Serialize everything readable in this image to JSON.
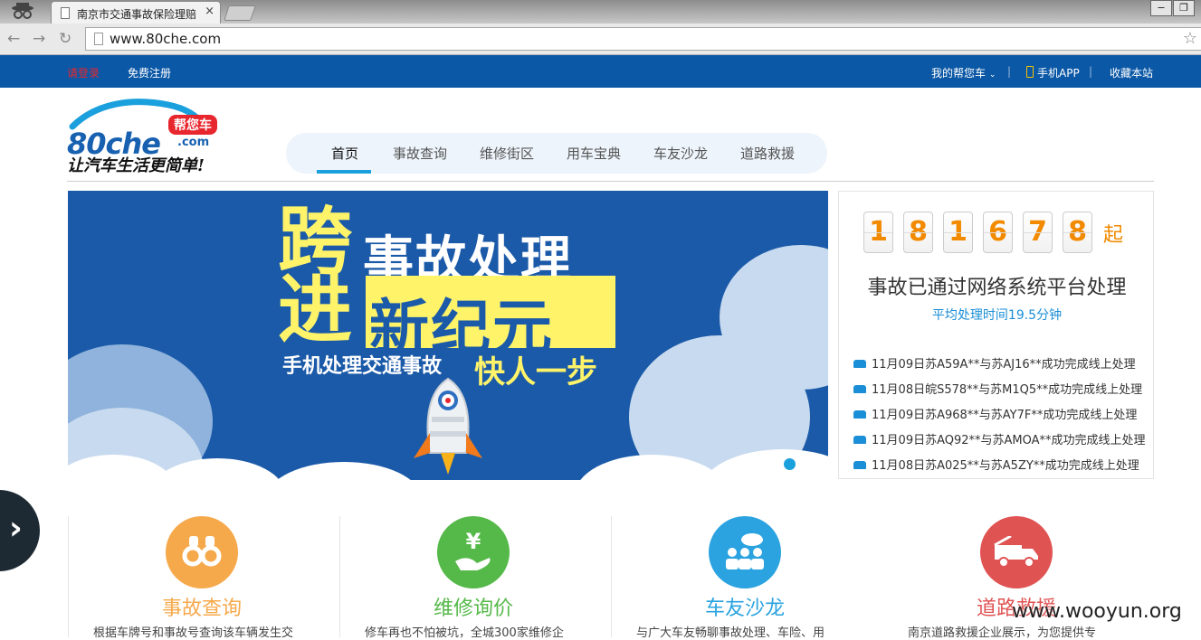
{
  "browser": {
    "tab_title": "南京市交通事故保险理赔",
    "tab_close": "×",
    "url": "www.80che.com",
    "window_minimize": "−",
    "window_restore": "❐"
  },
  "topbar": {
    "login": "请登录",
    "register": "免费注册",
    "my_account": "我的帮您车",
    "mobile_app": "手机APP",
    "bookmark": "收藏本站"
  },
  "logo": {
    "brand": "80che",
    "domain": ".com",
    "badge": "帮您车",
    "slogan": "让汽车生活更简单!"
  },
  "nav": {
    "items": [
      "首页",
      "事故查询",
      "维修街区",
      "用车宝典",
      "车友沙龙",
      "道路救援"
    ]
  },
  "banner": {
    "char_cross": "跨",
    "line1": "事故处理",
    "char_enter": "进",
    "new_era": "新纪元",
    "sub": "手机处理交通事故",
    "fast": "快人一步"
  },
  "stats": {
    "digits": [
      "1",
      "8",
      "1",
      "6",
      "7",
      "8"
    ],
    "unit": "起",
    "headline": "事故已通过网络系统平台处理",
    "avg_time": "平均处理时间19.5分钟",
    "records": [
      "11月09日苏A59A**与苏AJ16**成功完成线上处理",
      "11月08日皖S578**与苏M1Q5**成功完成线上处理",
      "11月09日苏A968**与苏AY7F**成功完成线上处理",
      "11月09日苏AQ92**与苏AMOA**成功完成线上处理",
      "11月08日苏A025**与苏A5ZY**成功完成线上处理"
    ]
  },
  "services": [
    {
      "name": "事故查询",
      "desc": "根据车牌号和事故号查询该车辆发生交",
      "icon": "binoculars-icon",
      "color": "#f6a94b"
    },
    {
      "name": "维修询价",
      "desc": "修车再也不怕被坑，全城300家维修企",
      "icon": "yen-hand-icon",
      "color": "#55b949"
    },
    {
      "name": "车友沙龙",
      "desc": "与广大车友畅聊事故处理、车险、用",
      "icon": "chat-people-icon",
      "color": "#2aa3e0"
    },
    {
      "name": "道路救援",
      "desc": "南京道路救援企业展示，为您提供专",
      "icon": "tow-truck-icon",
      "color": "#e05353"
    }
  ],
  "watermark": "www.wooyun.org",
  "colors": {
    "topbar": "#0b58a6",
    "accent": "#1aa0dd",
    "digit": "#f28a00",
    "banner": "#1b5aa8",
    "yellow": "#fff36a"
  }
}
